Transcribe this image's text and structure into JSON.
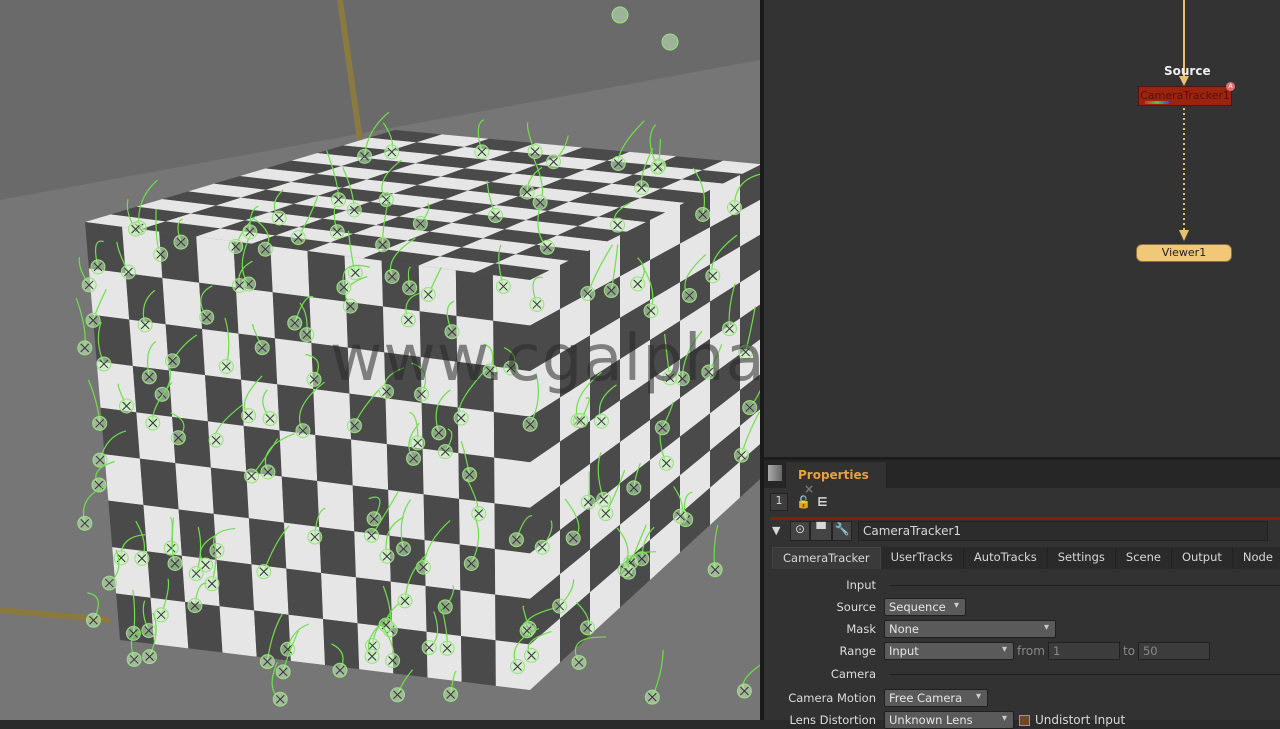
{
  "viewer": {
    "watermark": "www.cgalpha.com"
  },
  "nodegraph": {
    "source_label": "Source",
    "tracker_node": "CameraTracker1",
    "viewer_node": "Viewer1"
  },
  "properties": {
    "panel_title": "Properties",
    "close": "×",
    "panel_count": "1",
    "node_name": "CameraTracker1",
    "tabs": [
      "CameraTracker",
      "UserTracks",
      "AutoTracks",
      "Settings",
      "Scene",
      "Output",
      "Node"
    ],
    "input_section": "Input",
    "source": {
      "label": "Source",
      "value": "Sequence"
    },
    "mask": {
      "label": "Mask",
      "value": "None"
    },
    "range": {
      "label": "Range",
      "value": "Input",
      "from_label": "from",
      "from": "1",
      "to_label": "to",
      "to": "50"
    },
    "camera_section": "Camera",
    "camera_motion": {
      "label": "Camera Motion",
      "value": "Free Camera"
    },
    "lens_distortion": {
      "label": "Lens Distortion",
      "value": "Unknown Lens",
      "checkbox_label": "Undistort Input",
      "checked": false
    }
  },
  "colors": {
    "accent": "#e8a040",
    "tracker_node": "#9a2410",
    "viewer_node": "#f0c878",
    "track": "#6ee04a"
  }
}
